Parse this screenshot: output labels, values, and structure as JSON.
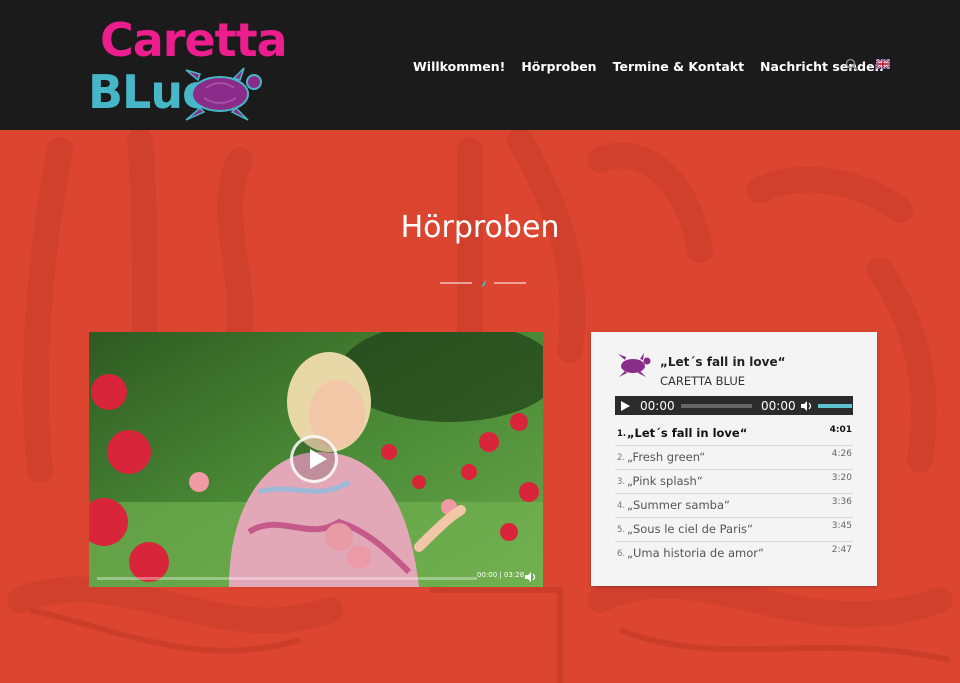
{
  "brand": {
    "logo_line1": "Caretta",
    "logo_line2": "BLue",
    "colors": {
      "pink": "#ec1d8d",
      "blue": "#47b7c8",
      "turtle": "#8b2c8a"
    }
  },
  "nav": {
    "items": [
      {
        "label": "Willkommen!"
      },
      {
        "label": "Hörproben"
      },
      {
        "label": "Termine & Kontakt"
      },
      {
        "label": "Nachricht senden"
      }
    ],
    "search_icon": "search-icon",
    "language_icon": "uk-flag-icon"
  },
  "page": {
    "title": "Hörproben",
    "background_color": "#dc4631"
  },
  "video": {
    "time": "00:00 | 03:28"
  },
  "player": {
    "title": "„Let´s fall in love“",
    "artist": "CARETTA BLUE",
    "current_time": "00:00",
    "duration": "00:00",
    "tracks": [
      {
        "num": "1.",
        "name": "„Let´s fall in love“",
        "dur": "4:01"
      },
      {
        "num": "2.",
        "name": "„Fresh green“",
        "dur": "4:26"
      },
      {
        "num": "3.",
        "name": "„Pink splash“",
        "dur": "3:20"
      },
      {
        "num": "4.",
        "name": "„Summer samba“",
        "dur": "3:36"
      },
      {
        "num": "5.",
        "name": "„Sous le ciel de Paris“",
        "dur": "3:45"
      },
      {
        "num": "6.",
        "name": "„Uma historia de amor“",
        "dur": "2:47"
      }
    ]
  }
}
